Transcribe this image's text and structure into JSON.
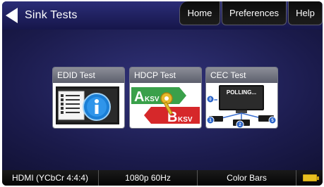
{
  "header": {
    "title": "Sink Tests",
    "nav": {
      "home": "Home",
      "preferences": "Preferences",
      "help": "Help"
    }
  },
  "tiles": [
    {
      "label": "EDID Test"
    },
    {
      "label": "HDCP Test",
      "left_badge": "Aksv",
      "right_badge": "Bksv"
    },
    {
      "label": "CEC Test",
      "screen_text": "POLLING...",
      "node_labels": [
        "0",
        "1",
        "2",
        "5"
      ]
    }
  ],
  "status_bar": {
    "interface": "HDMI (YCbCr 4:4:4)",
    "resolution": "1080p 60Hz",
    "pattern": "Color Bars",
    "battery_icon": "battery-icon"
  }
}
